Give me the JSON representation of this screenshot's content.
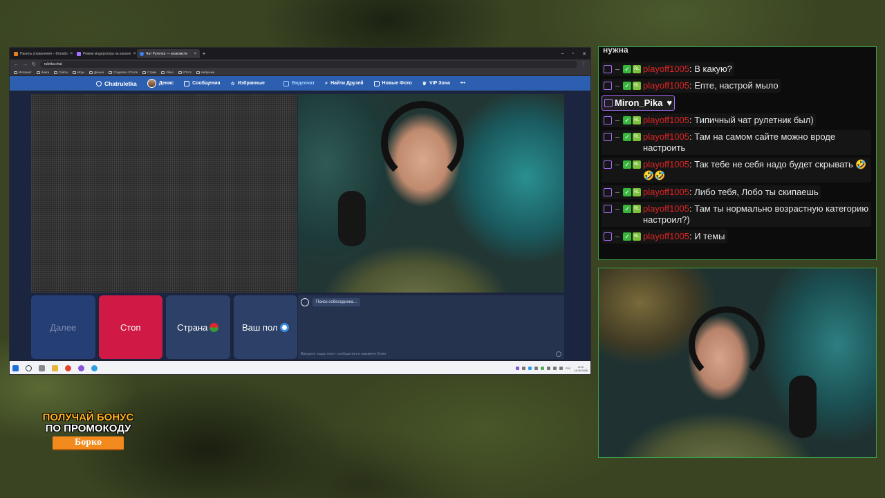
{
  "browser": {
    "tabs": [
      {
        "label": "Панель управления – Donatio",
        "color": "#e67e22",
        "active": false
      },
      {
        "label": "Режим модератора на канале",
        "color": "#a970ff",
        "active": false
      },
      {
        "label": "Чат Рулетка — знакомств",
        "color": "#3b82f6",
        "active": true
      }
    ],
    "new_tab": "+",
    "url": "ruletka.chat",
    "bookmarks": [
      "Интернет",
      "Книги",
      "Сайты",
      "Игры",
      "Деньги",
      "Социалка / Почта",
      "Стрим",
      "Video",
      "GTA 5",
      "Нейронки"
    ]
  },
  "site": {
    "logo": "Chatruletka",
    "nav": [
      {
        "label": "Денис",
        "type": "avatar"
      },
      {
        "label": "Сообщения"
      },
      {
        "label": "Избранные"
      },
      {
        "label": "Видеочат",
        "active": true
      },
      {
        "label": "Найти Друзей"
      },
      {
        "label": "Новые Фото"
      },
      {
        "label": "VIP Зона"
      },
      {
        "label": "•••"
      }
    ],
    "buttons": {
      "next": "Далее",
      "stop": "Стоп",
      "country": "Страна",
      "gender": "Ваш пол"
    },
    "searching": "Поиск собеседника...",
    "input_placeholder": "Введите сюда текст сообщения и нажмите Enter"
  },
  "taskbar": {
    "lang": "РУС",
    "time": "6:23",
    "date": "14.06.2026"
  },
  "chat": {
    "cut_top": "нужна",
    "messages": [
      {
        "user": "playoff1005",
        "text": ": В какую?"
      },
      {
        "user": "playoff1005",
        "text": ": Епте, настрой мыло"
      },
      {
        "user": "Miron_Pika",
        "text": "",
        "special": true
      },
      {
        "user": "playoff1005",
        "text": ": Типичный чат рулетник был)"
      },
      {
        "user": "playoff1005",
        "text": ": Там на самом сайте можно вроде настроить"
      },
      {
        "user": "playoff1005",
        "text": ": Так тебе не себя надо будет скрывать 🤣🤣🤣"
      },
      {
        "user": "playoff1005",
        "text": ": Либо тебя, Лобо ты скипаешь"
      },
      {
        "user": "playoff1005",
        "text": ": Там ты нормально возрастную категорию настроил?)"
      },
      {
        "user": "playoff1005",
        "text": ": И темы"
      }
    ]
  },
  "promo": {
    "line1": "ПОЛУЧАЙ БОНУС",
    "line2": "ПО ПРОМОКОДУ",
    "code": "Борко"
  },
  "colors": {
    "accent_green": "#3aa04a",
    "twitch_purple": "#a970ff",
    "stop_red": "#d01a45",
    "site_blue": "#2d5fb0"
  }
}
